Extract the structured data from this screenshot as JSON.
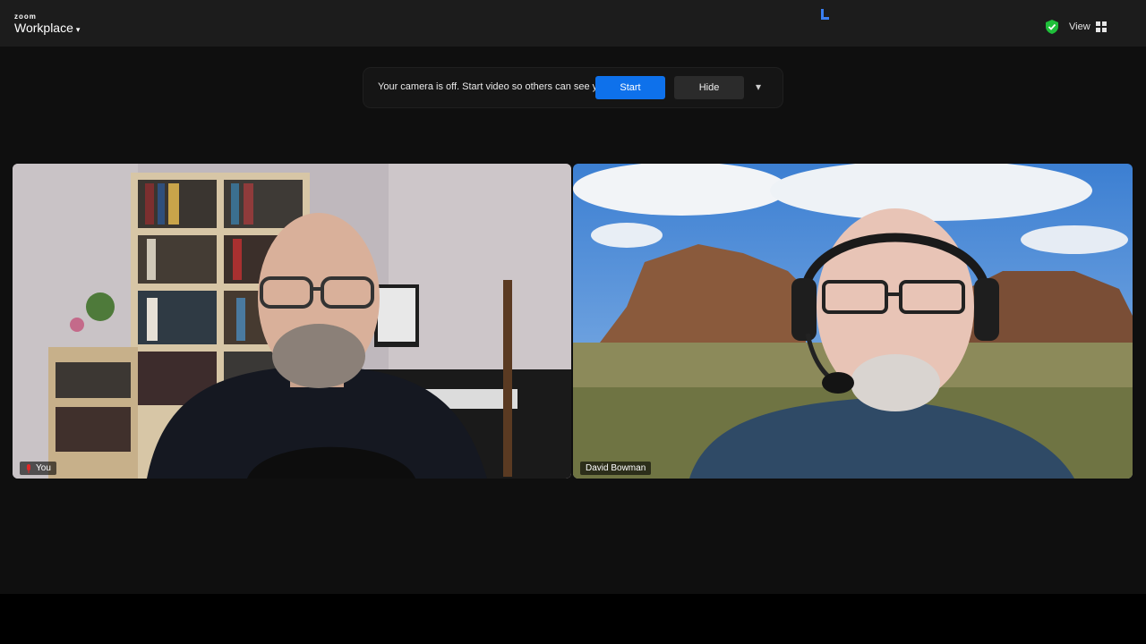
{
  "app": {
    "brand_top": "zoom",
    "brand_name": "Workplace",
    "caret": "▾"
  },
  "top_right": {
    "view_label": "View"
  },
  "banner": {
    "message": "Your camera is off. Start video so others can see you?",
    "primary_label": "Start",
    "secondary_label": "Hide",
    "more_label": "▾"
  },
  "participants": [
    {
      "name": "You"
    },
    {
      "name": "David Bowman"
    }
  ],
  "icons": {
    "security": "shield-check-icon",
    "speaker_view": "grid-icon",
    "mic": "mic-muted-icon"
  },
  "colors": {
    "accent": "#0e71eb",
    "security_green": "#1fbf3a",
    "mute_red": "#e02828"
  }
}
